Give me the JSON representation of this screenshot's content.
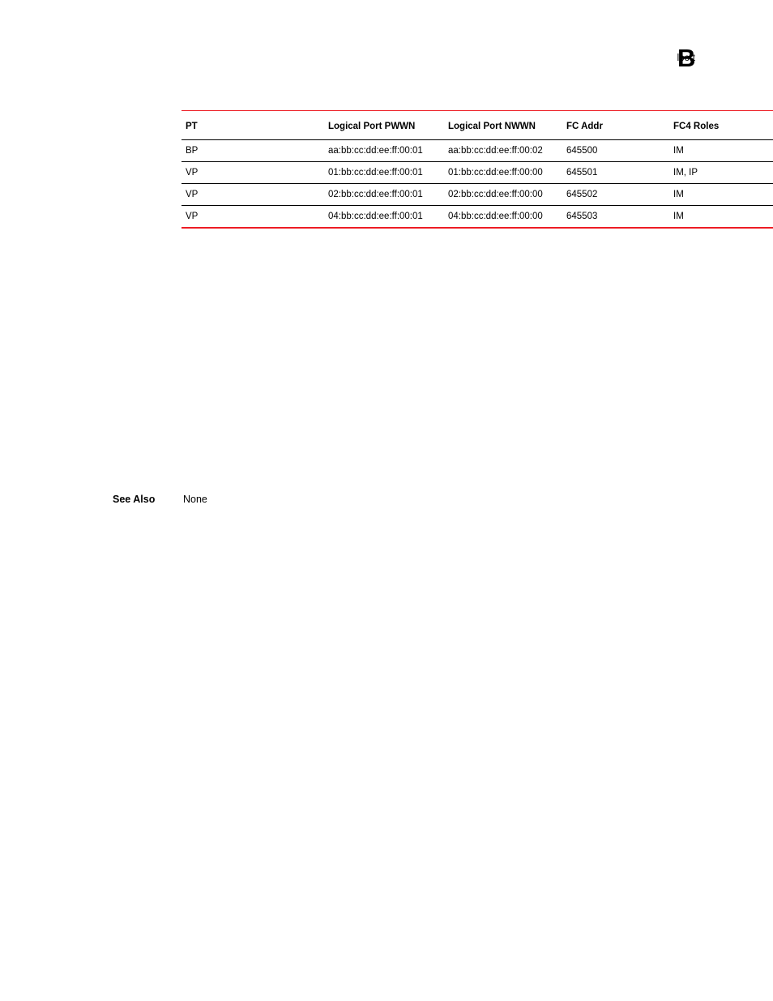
{
  "header": {
    "chapter_name": "lport",
    "appendix_letter": "B"
  },
  "table": {
    "columns": [
      "PT",
      "Logical Port PWWN",
      "Logical Port NWWN",
      "FC Addr",
      "FC4 Roles"
    ],
    "rows": [
      {
        "pt": "BP",
        "pwwn": "aa:bb:cc:dd:ee:ff:00:01",
        "nwwn": "aa:bb:cc:dd:ee:ff:00:02",
        "fc_addr": "645500",
        "fc4_roles": "IM"
      },
      {
        "pt": "VP",
        "pwwn": "01:bb:cc:dd:ee:ff:00:01",
        "nwwn": "01:bb:cc:dd:ee:ff:00:00",
        "fc_addr": "645501",
        "fc4_roles": "IM, IP"
      },
      {
        "pt": "VP",
        "pwwn": "02:bb:cc:dd:ee:ff:00:01",
        "nwwn": "02:bb:cc:dd:ee:ff:00:00",
        "fc_addr": "645502",
        "fc4_roles": "IM"
      },
      {
        "pt": "VP",
        "pwwn": "04:bb:cc:dd:ee:ff:00:01",
        "nwwn": "04:bb:cc:dd:ee:ff:00:00",
        "fc_addr": "645503",
        "fc4_roles": "IM"
      }
    ],
    "rule_color": "#ed1c24"
  },
  "see_also": {
    "label": "See Also",
    "value": "None"
  }
}
